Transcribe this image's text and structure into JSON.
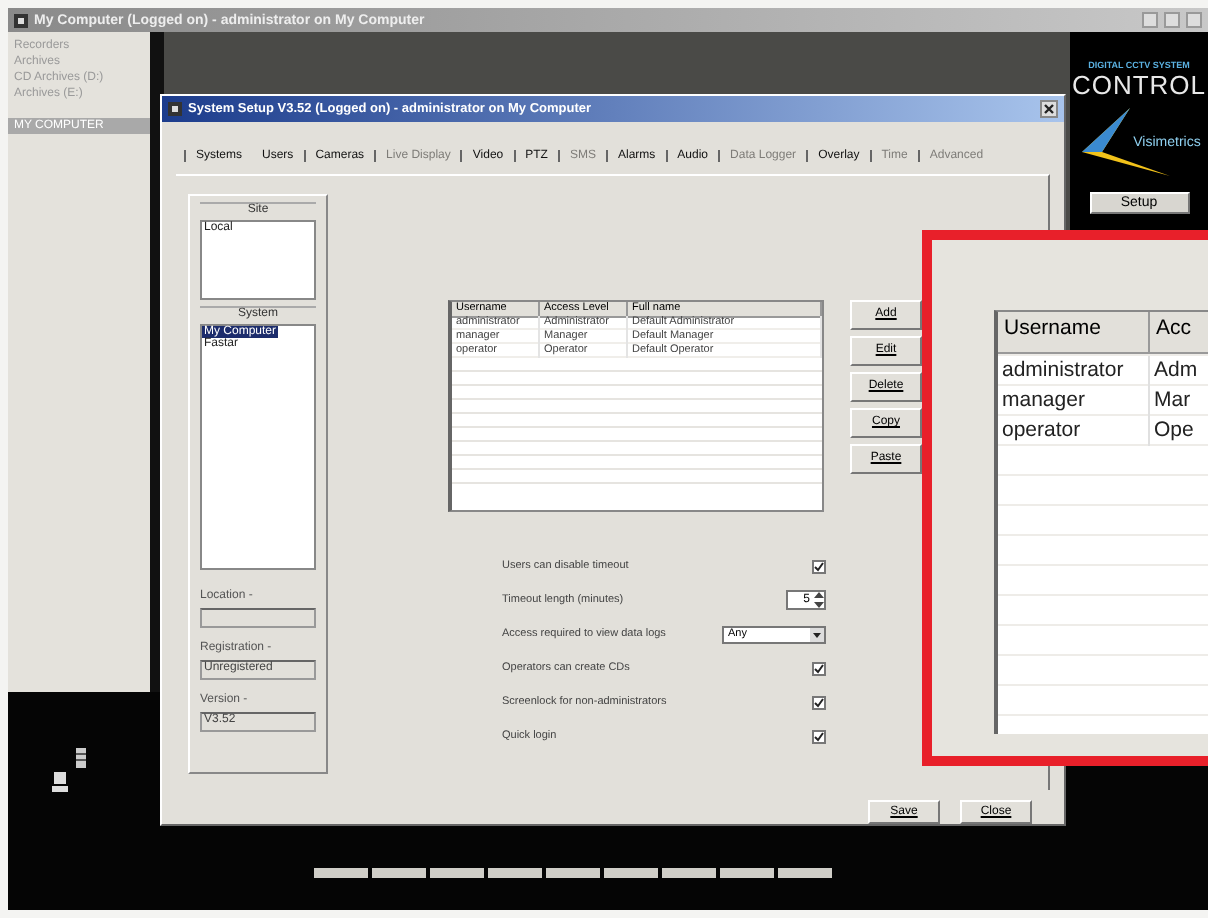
{
  "main_window": {
    "title": "My Computer (Logged on) - administrator on My Computer",
    "sidebar_items": [
      {
        "label": "Recorders",
        "selected": false
      },
      {
        "label": "Archives",
        "selected": false
      },
      {
        "label": "CD Archives (D:)",
        "selected": false
      },
      {
        "label": "Archives (E:)",
        "selected": false
      },
      {
        "label": "MY COMPUTER",
        "selected": true
      }
    ]
  },
  "brand_panel": {
    "tagline": "DIGITAL CCTV SYSTEM",
    "title": "CONTROL",
    "logo_text": "Visimetrics",
    "setup_button": "Setup"
  },
  "dialog": {
    "title": "System Setup V3.52 (Logged on) - administrator on My Computer",
    "tabs": [
      {
        "label": "Systems",
        "selected": false,
        "disabled": false
      },
      {
        "label": "Users",
        "selected": true,
        "disabled": false
      },
      {
        "label": "Cameras",
        "selected": false,
        "disabled": false
      },
      {
        "label": "Live Display",
        "selected": false,
        "disabled": true
      },
      {
        "label": "Video",
        "selected": false,
        "disabled": false
      },
      {
        "label": "PTZ",
        "selected": false,
        "disabled": false
      },
      {
        "label": "SMS",
        "selected": false,
        "disabled": true
      },
      {
        "label": "Alarms",
        "selected": false,
        "disabled": false
      },
      {
        "label": "Audio",
        "selected": false,
        "disabled": false
      },
      {
        "label": "Data Logger",
        "selected": false,
        "disabled": true
      },
      {
        "label": "Overlay",
        "selected": false,
        "disabled": false
      },
      {
        "label": "Time",
        "selected": false,
        "disabled": true
      },
      {
        "label": "Advanced",
        "selected": false,
        "disabled": true
      }
    ],
    "site": {
      "label": "Site",
      "items": [
        {
          "label": "Local",
          "selected": false
        }
      ]
    },
    "system": {
      "label": "System",
      "items": [
        {
          "label": "My Computer",
          "selected": true
        },
        {
          "label": "Fastar",
          "selected": false
        }
      ]
    },
    "fields": [
      {
        "label": "Location -"
      },
      {
        "label": "Registration -",
        "value": "Unregistered"
      },
      {
        "label": "Version -",
        "value": "V3.52"
      }
    ],
    "users_table": {
      "columns": [
        "Username",
        "Access Level",
        "Full name"
      ],
      "rows": [
        [
          "administrator",
          "Administrator",
          "Default Administrator"
        ],
        [
          "manager",
          "Manager",
          "Default Manager"
        ],
        [
          "operator",
          "Operator",
          "Default Operator"
        ]
      ]
    },
    "action_buttons": [
      "Add",
      "Edit",
      "Delete",
      "Copy",
      "Paste"
    ],
    "settings": [
      {
        "kind": "checkbox",
        "label": "Users can disable timeout",
        "checked": true
      },
      {
        "kind": "spinner",
        "label": "Timeout length (minutes)",
        "value": "5"
      },
      {
        "kind": "dropdown",
        "label": "Access required to view data logs",
        "value": "Any"
      },
      {
        "kind": "checkbox",
        "label": "Operators can create CDs",
        "checked": true
      },
      {
        "kind": "checkbox",
        "label": "Screenlock for non-administrators",
        "checked": true
      },
      {
        "kind": "checkbox",
        "label": "Quick login",
        "checked": true
      }
    ],
    "footer_buttons": [
      "Save",
      "Close"
    ]
  },
  "magnifier": {
    "columns": [
      "Username",
      "Acc"
    ],
    "rows": [
      [
        "administrator",
        "Adm"
      ],
      [
        "manager",
        "Mar"
      ],
      [
        "operator",
        "Ope"
      ]
    ]
  }
}
